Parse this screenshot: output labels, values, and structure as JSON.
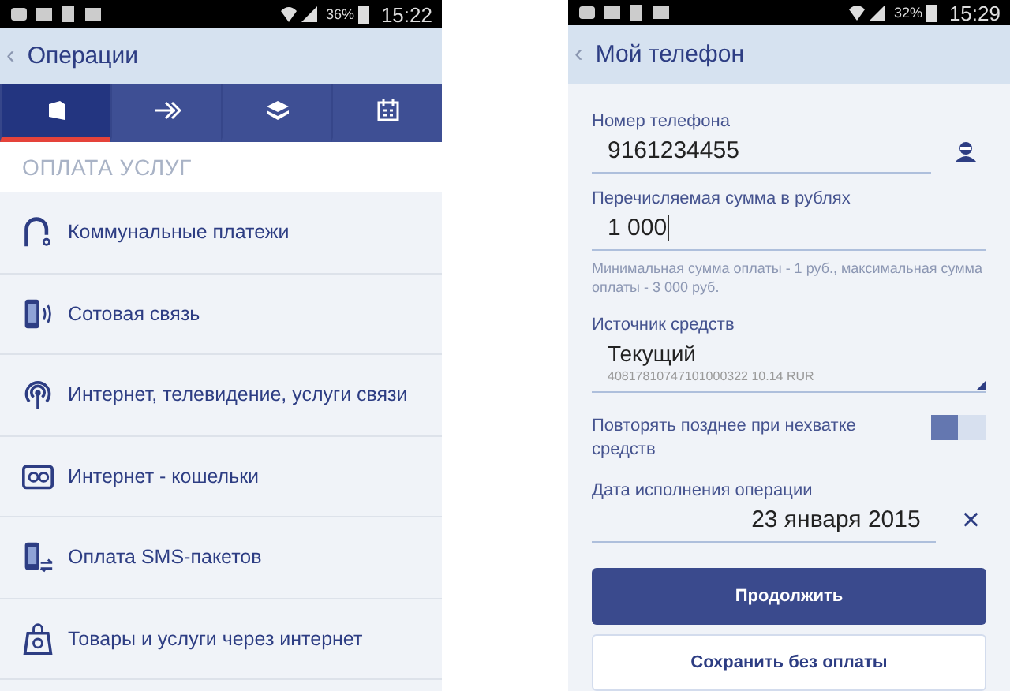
{
  "left_screen": {
    "status_bar": {
      "battery": "36%",
      "time": "15:22"
    },
    "header": {
      "back": "‹",
      "title": "Операции"
    },
    "tabs": [
      {
        "kind": "wallet",
        "selected": true
      },
      {
        "kind": "transfer",
        "selected": false
      },
      {
        "kind": "layers",
        "selected": false
      },
      {
        "kind": "calendar",
        "selected": false
      }
    ],
    "section_title": "ОПЛАТА УСЛУГ",
    "items": [
      {
        "kind": "utilities",
        "label": "Коммунальные платежи"
      },
      {
        "kind": "mobile",
        "label": "Сотовая связь"
      },
      {
        "kind": "antenna",
        "label": "Интернет, телевидение, услуги связи"
      },
      {
        "kind": "ewallet",
        "label": "Интернет - кошельки"
      },
      {
        "kind": "sms",
        "label": "Оплата SMS-пакетов"
      },
      {
        "kind": "shop",
        "label": "Товары и услуги через интернет"
      }
    ]
  },
  "right_screen": {
    "status_bar": {
      "battery": "32%",
      "time": "15:29"
    },
    "header": {
      "back": "‹",
      "title": "Мой телефон"
    },
    "phone_field": {
      "label": "Номер телефона",
      "value": "9161234455"
    },
    "amount_field": {
      "label": "Перечисляемая сумма в рублях",
      "value": "1 000",
      "hint": "Минимальная сумма оплаты - 1 руб., максимальная сумма оплаты - 3 000 руб."
    },
    "source_field": {
      "label": "Источник средств",
      "value": "Текущий",
      "account": "40817810747101000322 10.14 RUR"
    },
    "retry_toggle": {
      "label": "Повторять позднее при нехватке средств",
      "on": false
    },
    "date_field": {
      "label": "Дата исполнения операции",
      "value": "23 января 2015",
      "clear": "×"
    },
    "buttons": [
      {
        "kind": "primary",
        "label": "Продолжить"
      },
      {
        "kind": "secondary",
        "label": "Сохранить без оплаты"
      }
    ]
  }
}
